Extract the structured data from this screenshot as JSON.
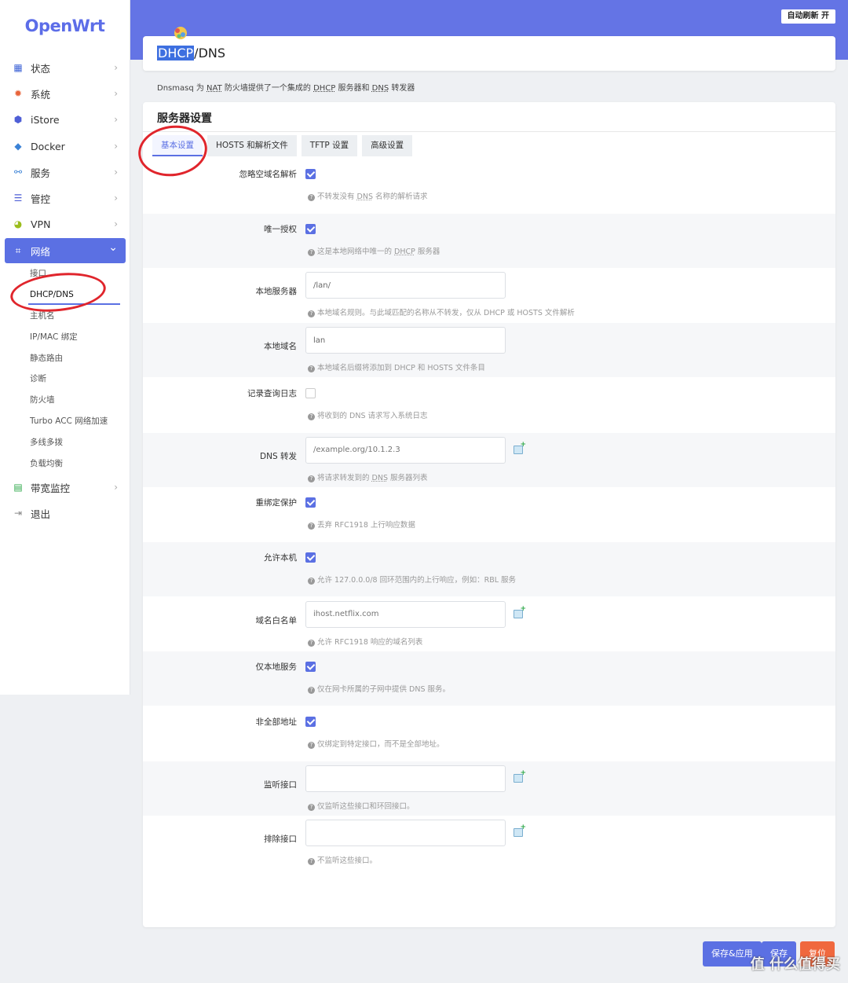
{
  "app": {
    "logo": "OpenWrt"
  },
  "header": {
    "refresh_button": "自动刷新 开",
    "title_highlight": "DHCP",
    "title_rest": "/DNS"
  },
  "description": {
    "parts": [
      "Dnsmasq 为 ",
      "NAT",
      " 防火墙提供了一个集成的 ",
      "DHCP",
      " 服务器和 ",
      "DNS",
      " 转发器"
    ]
  },
  "sidebar": {
    "items": [
      {
        "label": "状态",
        "icon": "dashboard-icon",
        "color": "#3f64d6"
      },
      {
        "label": "系统",
        "icon": "gear-icon",
        "color": "#e8643a"
      },
      {
        "label": "iStore",
        "icon": "cube-icon",
        "color": "#4f5fd6"
      },
      {
        "label": "Docker",
        "icon": "whale-icon",
        "color": "#3b82d6"
      },
      {
        "label": "服务",
        "icon": "services-icon",
        "color": "#3b82d6"
      },
      {
        "label": "管控",
        "icon": "control-icon",
        "color": "#4f5fd6"
      },
      {
        "label": "VPN",
        "icon": "vpn-icon",
        "color": "#9bbd1c"
      },
      {
        "label": "网络",
        "icon": "network-icon",
        "color": "#ffffff"
      },
      {
        "label": "带宽监控",
        "icon": "monitor-icon",
        "color": "#2ea84a"
      },
      {
        "label": "退出",
        "icon": "logout-icon",
        "color": "#888888"
      }
    ],
    "subitems": [
      "接口",
      "DHCP/DNS",
      "主机名",
      "IP/MAC 绑定",
      "静态路由",
      "诊断",
      "防火墙",
      "Turbo ACC 网络加速",
      "多线多拨",
      "负载均衡"
    ]
  },
  "card": {
    "title": "服务器设置",
    "tabs": [
      "基本设置",
      "HOSTS 和解析文件",
      "TFTP 设置",
      "高级设置"
    ]
  },
  "fields": [
    {
      "label": "忽略空域名解析",
      "type": "checkbox",
      "checked": true,
      "help": [
        "不转发没有 ",
        "DNS",
        " 名称的解析请求"
      ]
    },
    {
      "label": "唯一授权",
      "type": "checkbox",
      "checked": true,
      "help": [
        "这是本地网络中唯一的 ",
        "DHCP",
        " 服务器"
      ]
    },
    {
      "label": "本地服务器",
      "type": "text",
      "value": "/lan/",
      "help": [
        "本地域名规则。与此域匹配的名称从不转发，仅从 DHCP 或 HOSTS 文件解析"
      ]
    },
    {
      "label": "本地域名",
      "type": "text",
      "value": "lan",
      "help": [
        "本地域名后缀将添加到 DHCP 和 HOSTS 文件条目"
      ]
    },
    {
      "label": "记录查询日志",
      "type": "checkbox",
      "checked": false,
      "help": [
        "将收到的 DNS 请求写入系统日志"
      ]
    },
    {
      "label": "DNS 转发",
      "type": "text",
      "value": "",
      "placeholder": "/example.org/10.1.2.3",
      "add": true,
      "help": [
        "将请求转发到的 ",
        "DNS",
        " 服务器列表"
      ]
    },
    {
      "label": "重绑定保护",
      "type": "checkbox",
      "checked": true,
      "help": [
        "丢弃 RFC1918 上行响应数据"
      ]
    },
    {
      "label": "允许本机",
      "type": "checkbox",
      "checked": true,
      "help": [
        "允许 127.0.0.0/8 回环范围内的上行响应，例如：RBL 服务"
      ]
    },
    {
      "label": "域名白名单",
      "type": "text",
      "value": "",
      "placeholder": "ihost.netflix.com",
      "add": true,
      "help": [
        "允许 RFC1918 响应的域名列表"
      ]
    },
    {
      "label": "仅本地服务",
      "type": "checkbox",
      "checked": true,
      "help": [
        "仅在网卡所属的子网中提供 DNS 服务。"
      ]
    },
    {
      "label": "非全部地址",
      "type": "checkbox",
      "checked": true,
      "help": [
        "仅绑定到特定接口，而不是全部地址。"
      ]
    },
    {
      "label": "监听接口",
      "type": "text",
      "value": "",
      "add": true,
      "help": [
        "仅监听这些接口和环回接口。"
      ]
    },
    {
      "label": "排除接口",
      "type": "text",
      "value": "",
      "add": true,
      "help": [
        "不监听这些接口。"
      ]
    }
  ],
  "buttons": {
    "save_apply": "保存&应用",
    "save": "保存",
    "reset": "复位"
  },
  "watermark": "值 什么值得买",
  "colors": {
    "accent": "#5b70e3",
    "danger": "#f0683e",
    "header": "#6474e5"
  }
}
